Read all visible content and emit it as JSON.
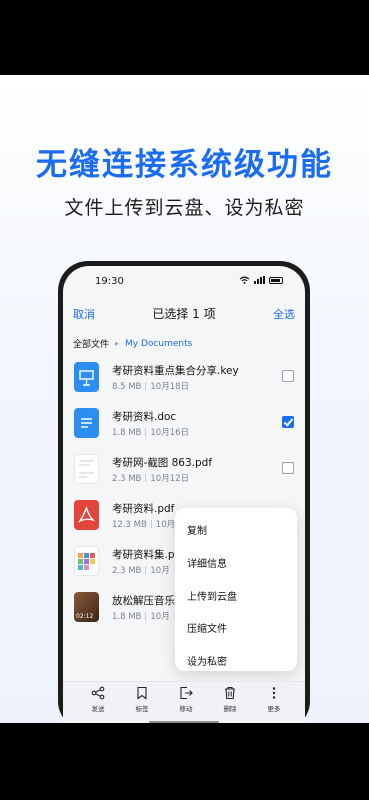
{
  "promo": {
    "headline": "无缝连接系统级功能",
    "subline": "文件上传到云盘、设为私密"
  },
  "status_bar": {
    "time": "19:30"
  },
  "top_bar": {
    "cancel_label": "取消",
    "title": "已选择 1 项",
    "select_all_label": "全选"
  },
  "breadcrumb": {
    "root": "全部文件",
    "current": "My Documents"
  },
  "files": [
    {
      "name": "考研资料重点集合分享.key",
      "size": "8.5 MB",
      "date": "10月18日",
      "icon": "keynote-icon",
      "selected": false
    },
    {
      "name": "考研资料.doc",
      "size": "1.8 MB",
      "date": "10月16日",
      "icon": "doc-icon",
      "selected": true
    },
    {
      "name": "考研网-截图 863.pdf",
      "size": "2.3 MB",
      "date": "10月12日",
      "icon": "pdf-thumbnail-icon",
      "selected": false
    },
    {
      "name": "考研资料.pdf",
      "size": "12.3 MB",
      "date": "10月",
      "icon": "pdf-icon",
      "selected": false
    },
    {
      "name": "考研资料集.p",
      "size": "2.3 MB",
      "date": "10月",
      "icon": "image-grid-icon",
      "selected": false
    },
    {
      "name": "放松解压音乐",
      "size": "1.8 MB",
      "date": "10月",
      "icon": "video-thumbnail-icon",
      "selected": false,
      "duration": "02:12"
    }
  ],
  "context_menu": {
    "items": [
      "复制",
      "详细信息",
      "上传到云盘",
      "压缩文件",
      "设为私密"
    ]
  },
  "bottom_toolbar": {
    "items": [
      {
        "label": "发送",
        "icon": "share-icon"
      },
      {
        "label": "标签",
        "icon": "bookmark-icon"
      },
      {
        "label": "移动",
        "icon": "move-icon"
      },
      {
        "label": "删除",
        "icon": "trash-icon"
      },
      {
        "label": "更多",
        "icon": "more-vertical-icon"
      }
    ]
  },
  "colors": {
    "accent": "#1a6cf0",
    "pdf_red": "#e2453c",
    "doc_blue": "#2b8ef0"
  }
}
